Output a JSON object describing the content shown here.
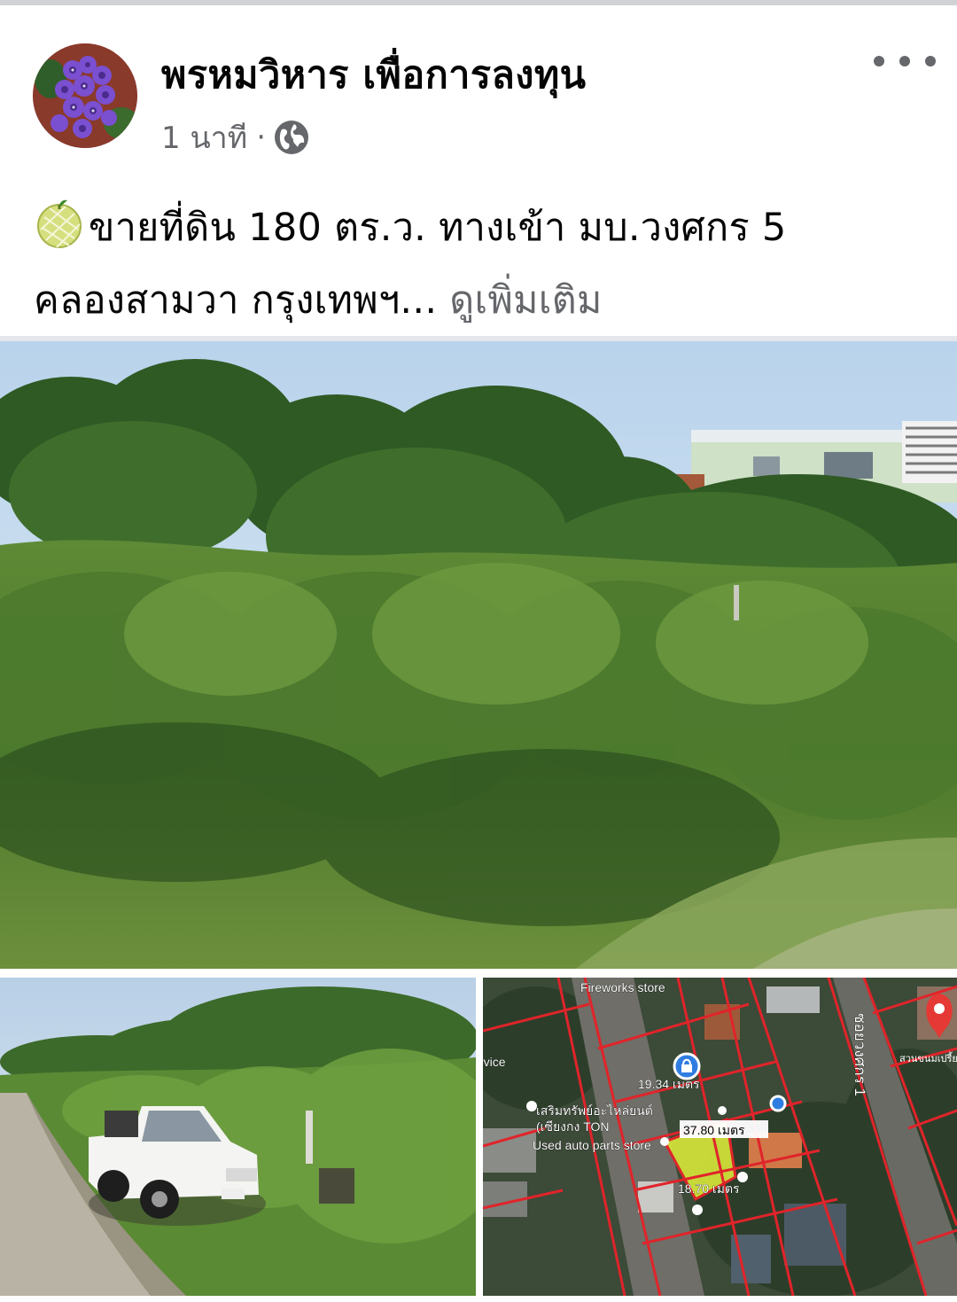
{
  "post": {
    "page_name": "พรหมวิหาร เพื่อการลงทุน",
    "timestamp": "1 นาที",
    "separator": "·",
    "privacy_icon": "globe-icon",
    "more_icon": "more-options-icon",
    "avatar_icon": "purple-flower-avatar",
    "text_emoji": "melon-emoji",
    "text_line1": "ขายที่ดิน 180 ตร.ว. ทางเข้า มบ.วงศกร 5",
    "text_line2": "คลองสามวา กรุงเทพฯ...",
    "see_more": "ดูเพิ่มเติม"
  },
  "photos": {
    "main": "overgrown-land-street-view",
    "bottom_left": "roadside-land-with-pickup-truck",
    "bottom_right": {
      "kind": "satellite-parcel-map",
      "labels": {
        "fireworks": "Fireworks store",
        "service": "rvice",
        "width_top": "19.34 เมตร",
        "length": "37.80 เมตร",
        "width_bottom": "18.70 เมตร",
        "shop_name": "เสริมทรัพย์อะไหล่ยนต์",
        "shop_name2": "(เซียงกง TON",
        "shop_type": "Used auto parts store",
        "road": "ซอยวงศกร 1",
        "map_corner": "สวนขนมเปรี้ย"
      }
    }
  },
  "colors": {
    "secondary_text": "#65676b",
    "divider": "#e4e6eb",
    "parcel_lines": "#e0242a",
    "parcel_fill": "#d8e83a",
    "pin": "#e53935"
  }
}
